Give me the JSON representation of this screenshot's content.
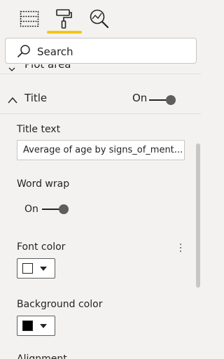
{
  "toolbar": {
    "tabs": [
      {
        "name": "fields",
        "icon": "table-grid-icon",
        "active": false
      },
      {
        "name": "format",
        "icon": "paint-roller-icon",
        "active": true
      },
      {
        "name": "analytics",
        "icon": "analytics-magnifier-icon",
        "active": false
      }
    ],
    "active_color": "#f2c811"
  },
  "search": {
    "placeholder": "Search"
  },
  "collapsed_section": {
    "label": "Plot area"
  },
  "title_section": {
    "label": "Title",
    "state": "On",
    "expanded": true
  },
  "title_text": {
    "label": "Title text",
    "value": "Average of age by signs_of_ment..."
  },
  "word_wrap": {
    "label": "Word wrap",
    "state": "On"
  },
  "font_color": {
    "label": "Font color",
    "value": "#ffffff"
  },
  "background_color": {
    "label": "Background color",
    "value": "#000000"
  },
  "next_field": {
    "label": "Alignment"
  }
}
